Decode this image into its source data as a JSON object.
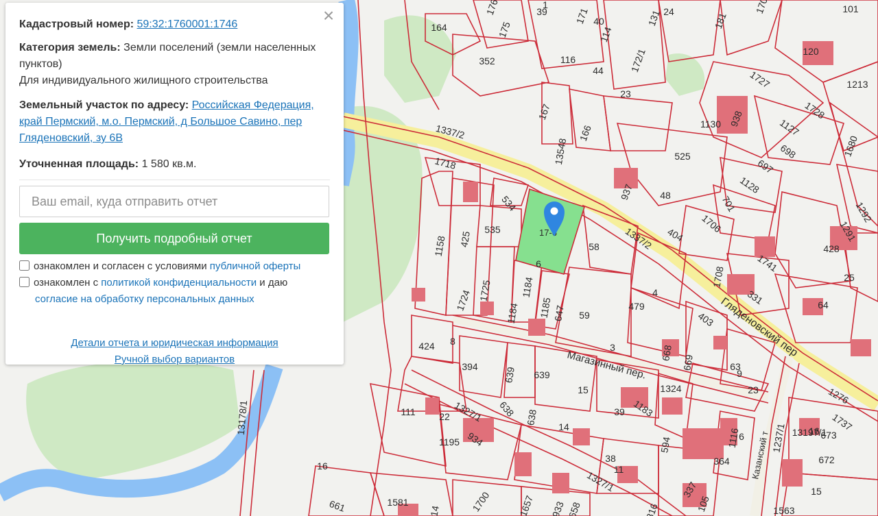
{
  "card": {
    "cadastral_label": "Кадастровый номер:",
    "cadastral_value": "59:32:1760001:1746",
    "category_label": "Категория земель:",
    "category_value": "Земли поселений (земли населенных пунктов)",
    "permitted_use": "Для индивидуального жилищного строительства",
    "address_label": "Земельный участок по адресу:",
    "address_value": "Российская Федерация, край Пермский, м.о. Пермский, д Большое Савино, пер Гляденовский, зу 6В",
    "area_label": "Уточненная площадь:",
    "area_value": "1 580 кв.м.",
    "close_glyph": "×"
  },
  "form": {
    "email_placeholder": "Ваш email, куда отправить отчет",
    "submit_label": "Получить подробный отчет",
    "offer_prefix": "ознакомлен и согласен с условиями ",
    "offer_link": "публичной оферты",
    "privacy_prefix": "ознакомлен с ",
    "privacy_link": "политикой конфиденциальности",
    "privacy_middle": " и даю",
    "consent_link": "согласие на обработку персональных данных"
  },
  "footer": {
    "details_link": "Детали отчета и юридическая информация",
    "manual_link": "Ручной выбор вариантов"
  },
  "map": {
    "streets": {
      "glyadenovsky": "Гляденовский пер",
      "magazinny": "Магазинный пер.",
      "kazansky": "Казанский т"
    },
    "selected_parcel": "17-6",
    "parcel_numbers": [
      "164",
      "175",
      "176",
      "39",
      "171",
      "40",
      "114",
      "131",
      "24",
      "181",
      "101",
      "170",
      "120",
      "1213",
      "352",
      "116",
      "44",
      "172/1",
      "23",
      "1727",
      "167",
      "13548",
      "166",
      "1337/2",
      "938",
      "1130",
      "1728",
      "1127",
      "1718",
      "698",
      "1680",
      "525",
      "697",
      "937",
      "48",
      "1128",
      "534",
      "535",
      "425",
      "701",
      "1292",
      "1158",
      "58",
      "1337/2",
      "404",
      "1706",
      "428",
      "1291",
      "1741",
      "1708",
      "1184",
      "1725",
      "1724",
      "1184",
      "1185",
      "647",
      "59",
      "479",
      "4",
      "331",
      "64",
      "403",
      "424",
      "8",
      "394",
      "639",
      "639",
      "668",
      "669",
      "63",
      "3",
      "15",
      "1324",
      "23",
      "638",
      "638",
      "39",
      "1183",
      "111",
      "22",
      "1327/1",
      "1195",
      "934",
      "14",
      "594",
      "1116",
      "6",
      "1737",
      "673",
      "672",
      "16",
      "13178/1",
      "38",
      "11",
      "364",
      "1700",
      "1327/1",
      "1657",
      "933",
      "658",
      "337",
      "105",
      "816",
      "661",
      "1581",
      "114",
      "15",
      "1563",
      "1276",
      "1237/1",
      "13197/1",
      "16",
      "25",
      "9",
      "6",
      "1",
      "8"
    ],
    "marker_icon": "map-pin-icon"
  },
  "colors": {
    "accent": "#4cb35e",
    "link": "#1a73b8",
    "parcel_line": "#cc2b38",
    "building": "#e0707a",
    "selected_parcel": "#86e08f",
    "river": "#8cc0f5",
    "road": "#f6ef9c",
    "greenery": "#cfe9c4"
  }
}
